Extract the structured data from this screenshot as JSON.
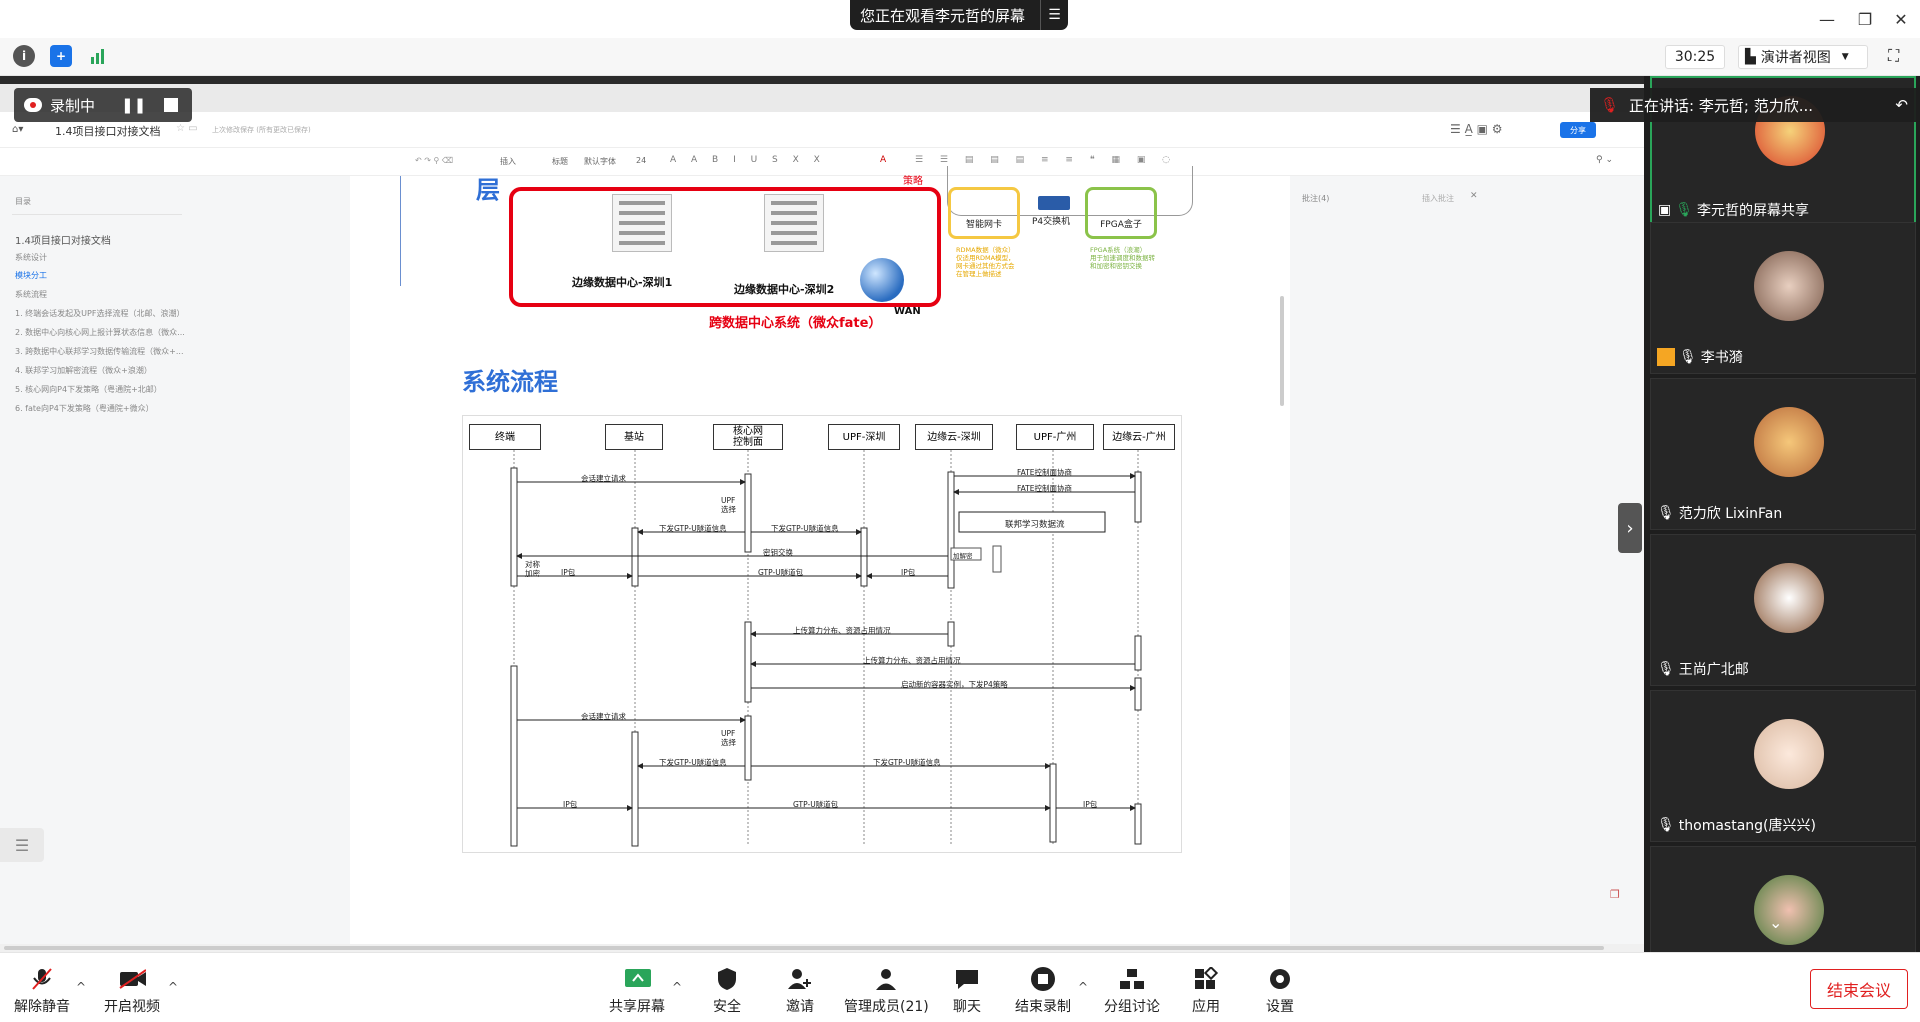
{
  "meeting": {
    "share_banner": "您正在观看李元哲的屏幕",
    "timer": "30:25",
    "view_mode": "演讲者视图",
    "recording_label": "录制中",
    "speaking": "正在讲话: 李元哲; 范力欣..."
  },
  "document": {
    "title": "1.4项目接口对接文档",
    "save_status": "上次修改保存 (所有更改已保存)",
    "share_button": "分享",
    "font_size": "24",
    "heading_style": "标题",
    "font_name": "默认字体",
    "insert_label": "插入",
    "comment_panel_title": "批注(4)",
    "comment_panel_action": "插入批注",
    "section_heading": "系统流程",
    "outline": {
      "title": "目录",
      "items": [
        "1.4项目接口对接文档",
        "系统设计",
        "模块分工",
        "系统流程",
        "1. 终端会话发起及UPF选择流程（北邮、浪潮）",
        "2. 数据中心向核心网上报计算状态信息（微众...",
        "3. 跨数据中心联邦学习数据传输流程（微众+...",
        "4. 联邦学习加解密流程（微众+浪潮）",
        "5. 核心网向P4下发策略（粤通院+北邮）",
        "6. fate向P4下发策略（粤通院+微众）"
      ]
    }
  },
  "arch_diagram": {
    "layer_char": "层",
    "dc1": "边缘数据中心-深圳1",
    "dc2": "边缘数据中心-深圳2",
    "wan": "WAN",
    "system": "跨数据中心系统（微众fate）",
    "label_top": "策略",
    "nic": "智能网卡",
    "nic_note": "RDMA数据（微众）\n仅适用RDMA模型，\n网卡通过其他方式会\n在管理上做描述",
    "p4": "P4交换机",
    "fpga": "FPGA盒子",
    "fpga_note": "FPGA系统（浪潮）\n用于加速调度和数据转\n和加密和密钥交换"
  },
  "sequence": {
    "actors": [
      "终端",
      "基站",
      "核心网\n控制面",
      "UPF-深圳",
      "边缘云-深圳",
      "UPF-广州",
      "边缘云-广州"
    ],
    "messages": [
      "会话建立请求",
      "UPF\n选择",
      "下发GTP-U隧道信息",
      "下发GTP-U隧道信息",
      "FATE控制面协商",
      "FATE控制面协商",
      "联邦学习数据流",
      "密钥交换",
      "加解密",
      "对称\n加密",
      "IP包",
      "GTP-U隧道包",
      "IP包",
      "上传算力分布、资源占用情况",
      "上传算力分布、资源占用情况",
      "启动新的容器实例，下发P4策略",
      "会话建立请求",
      "UPF\n选择",
      "下发GTP-U隧道信息",
      "下发GTP-U隧道信息",
      "IP包",
      "GTP-U隧道包",
      "IP包"
    ],
    "fpga_label": "FPGA"
  },
  "participants": [
    {
      "name": "李元哲的屏幕共享",
      "color": "#d9412a"
    },
    {
      "name": "李书漪",
      "color": "#b88a6a"
    },
    {
      "name": "范力欣 LixinFan",
      "color": "#d99a5a"
    },
    {
      "name": "王尚广北邮",
      "color": "#8a5a3a"
    },
    {
      "name": "thomastang(唐兴兴)",
      "color": "#f0e6dc"
    },
    {
      "name": "",
      "color": "#6a9a5a"
    }
  ],
  "bottom_bar": {
    "unmute": "解除静音",
    "video": "开启视频",
    "share": "共享屏幕",
    "security": "安全",
    "invite": "邀请",
    "manage": "管理成员(21)",
    "chat": "聊天",
    "stop_record": "结束录制",
    "breakout": "分组讨论",
    "apps": "应用",
    "settings": "设置",
    "end": "结束会议"
  },
  "colors": {
    "accent_blue": "#1a73e8",
    "end_red": "#e02020",
    "diagram_red": "#e60012",
    "heading_blue": "#2f6fd6"
  }
}
